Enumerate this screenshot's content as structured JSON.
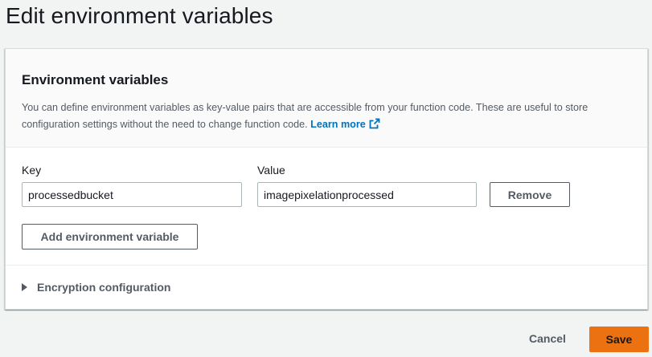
{
  "page": {
    "title": "Edit environment variables"
  },
  "panel": {
    "heading": "Environment variables",
    "description": "You can define environment variables as key-value pairs that are accessible from your function code. These are useful to store configuration settings without the need to change function code.",
    "learn_more": "Learn more",
    "learn_more_icon": "external-link-icon"
  },
  "form": {
    "key_label": "Key",
    "value_label": "Value",
    "rows": [
      {
        "key": "processedbucket",
        "value": "imagepixelationprocessed",
        "remove_label": "Remove"
      }
    ],
    "add_label": "Add environment variable"
  },
  "encryption": {
    "label": "Encryption configuration",
    "icon": "caret-right-icon"
  },
  "footer": {
    "cancel_label": "Cancel",
    "save_label": "Save"
  },
  "colors": {
    "primary": "#ec7211",
    "link": "#0073bb",
    "background": "#f2f3f3"
  }
}
